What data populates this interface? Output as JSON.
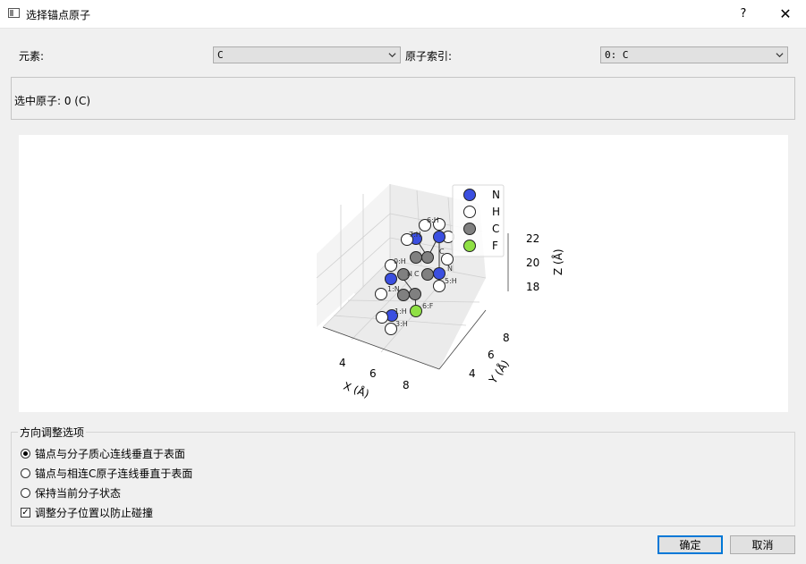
{
  "window": {
    "title": "选择锚点原子",
    "help": "?",
    "close": "✕"
  },
  "element_label": "元素:",
  "element_value": "C",
  "index_label": "原子索引:",
  "index_value": "0: C",
  "selected_text": "选中原子: 0 (C)",
  "plot": {
    "legend": [
      {
        "name": "N",
        "color": "#3b4fe0"
      },
      {
        "name": "H",
        "color": "#ffffff"
      },
      {
        "name": "C",
        "color": "#808080"
      },
      {
        "name": "F",
        "color": "#8fe044"
      }
    ],
    "x_ticks": [
      "4",
      "6",
      "8"
    ],
    "y_ticks": [
      "4",
      "6",
      "8"
    ],
    "z_ticks": [
      "18",
      "20",
      "22"
    ],
    "x_label": "X (Å)",
    "y_label": "Y (Å)",
    "z_label": "Z (Å)",
    "atom_labels": [
      "6:H",
      "7:H",
      "0:H",
      "N",
      "C",
      "C",
      "N",
      "1:N",
      "5:H",
      "1:H",
      "6:F",
      "3:H"
    ]
  },
  "options": {
    "title": "方向调整选项",
    "opt1": "锚点与分子质心连线垂直于表面",
    "opt2": "锚点与相连C原子连线垂直于表面",
    "opt3": "保持当前分子状态",
    "opt4": "调整分子位置以防止碰撞"
  },
  "buttons": {
    "ok": "确定",
    "cancel": "取消"
  }
}
